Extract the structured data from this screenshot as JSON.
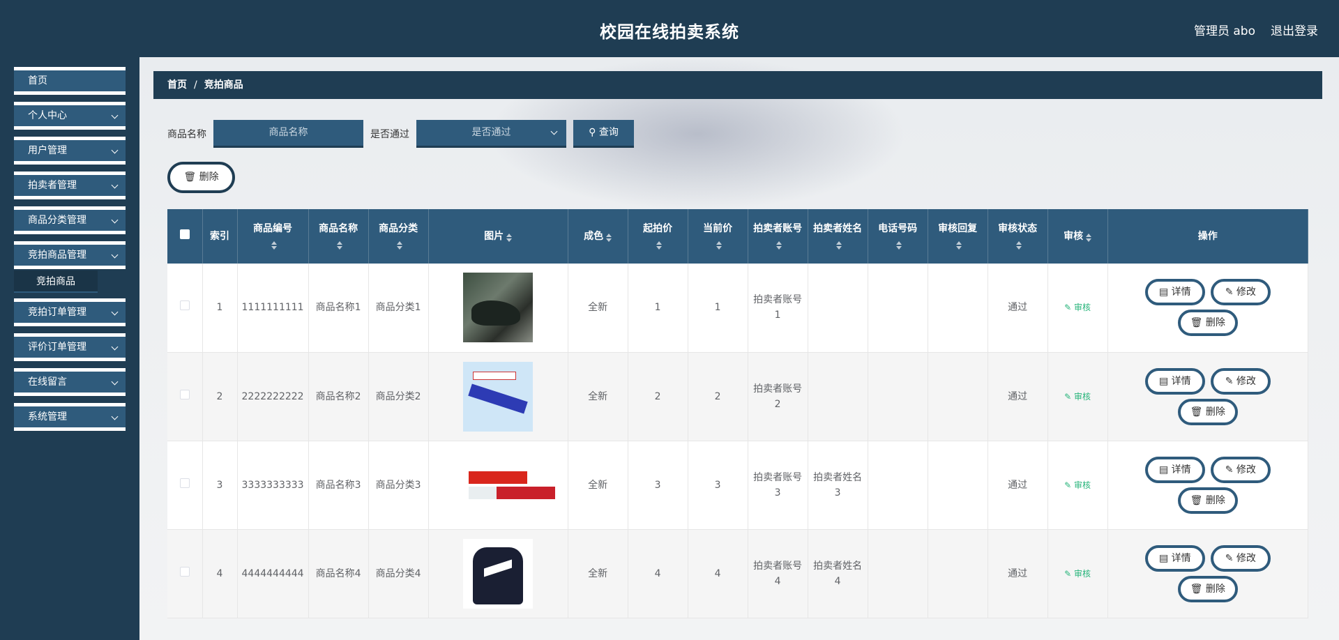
{
  "header": {
    "title": "校园在线拍卖系统",
    "admin": "管理员 abo",
    "logout": "退出登录"
  },
  "sidebar": {
    "items": [
      {
        "label": "首页",
        "has_children": false
      },
      {
        "label": "个人中心",
        "has_children": true
      },
      {
        "label": "用户管理",
        "has_children": true
      },
      {
        "label": "拍卖者管理",
        "has_children": true
      },
      {
        "label": "商品分类管理",
        "has_children": true
      },
      {
        "label": "竞拍商品管理",
        "has_children": true
      },
      {
        "label": "竞拍订单管理",
        "has_children": true
      },
      {
        "label": "评价订单管理",
        "has_children": true
      },
      {
        "label": "在线留言",
        "has_children": true
      },
      {
        "label": "系统管理",
        "has_children": true
      }
    ],
    "subitem": "竞拍商品"
  },
  "breadcrumb": {
    "home": "首页",
    "sep": "/",
    "current": "竞拍商品"
  },
  "search": {
    "name_label": "商品名称",
    "name_placeholder": "商品名称",
    "pass_label": "是否通过",
    "pass_placeholder": "是否通过",
    "query_label": "查询"
  },
  "actions": {
    "delete_label": "删除"
  },
  "table": {
    "headers": [
      "索引",
      "商品编号",
      "商品名称",
      "商品分类",
      "图片",
      "成色",
      "起拍价",
      "当前价",
      "拍卖者账号",
      "拍卖者姓名",
      "电话号码",
      "审核回复",
      "审核状态",
      "审核",
      "操作"
    ],
    "rows": [
      {
        "index": "1",
        "code": "1111111111",
        "name": "商品名称1",
        "category": "商品分类1",
        "image": "shoes",
        "condition": "全新",
        "start": "1",
        "current": "1",
        "account": "拍卖者账号1",
        "seller": "",
        "phone": "",
        "reply": "",
        "status": "通过",
        "audit": "审核"
      },
      {
        "index": "2",
        "code": "2222222222",
        "name": "商品名称2",
        "category": "商品分类2",
        "image": "toothpaste",
        "condition": "全新",
        "start": "2",
        "current": "2",
        "account": "拍卖者账号2",
        "seller": "",
        "phone": "",
        "reply": "",
        "status": "通过",
        "audit": "审核"
      },
      {
        "index": "3",
        "code": "3333333333",
        "name": "商品名称3",
        "category": "商品分类3",
        "image": "colgate",
        "condition": "全新",
        "start": "3",
        "current": "3",
        "account": "拍卖者账号3",
        "seller": "拍卖者姓名3",
        "phone": "",
        "reply": "",
        "status": "通过",
        "audit": "审核"
      },
      {
        "index": "4",
        "code": "4444444444",
        "name": "商品名称4",
        "category": "商品分类4",
        "image": "jacket",
        "condition": "全新",
        "start": "4",
        "current": "4",
        "account": "拍卖者账号4",
        "seller": "拍卖者姓名4",
        "phone": "",
        "reply": "",
        "status": "通过",
        "audit": "审核"
      }
    ],
    "op_detail": "详情",
    "op_edit": "修改",
    "op_delete": "删除"
  }
}
